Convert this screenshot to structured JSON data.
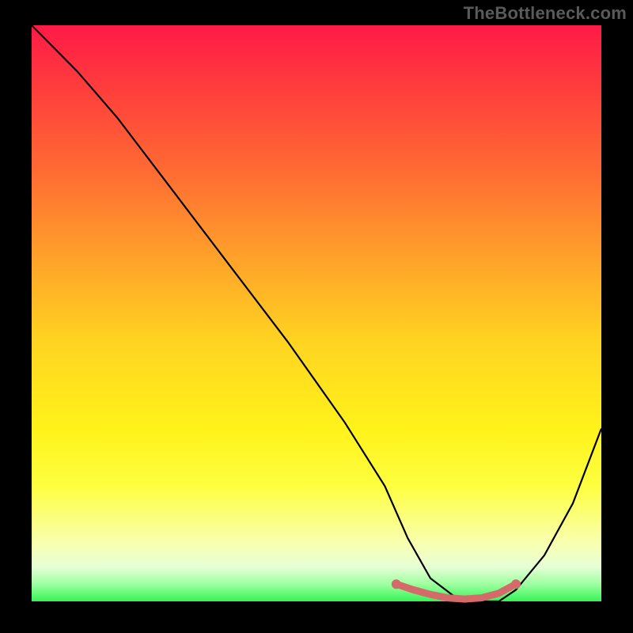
{
  "watermark": "TheBottleneck.com",
  "chart_data": {
    "type": "line",
    "title": "",
    "xlabel": "",
    "ylabel": "",
    "xlim": [
      0,
      100
    ],
    "ylim": [
      0,
      100
    ],
    "series": [
      {
        "name": "bottleneck-curve",
        "x": [
          0,
          3,
          8,
          15,
          25,
          35,
          45,
          55,
          62,
          66,
          70,
          74,
          78,
          82,
          85,
          90,
          95,
          100
        ],
        "values": [
          100,
          97,
          92,
          84,
          71,
          58,
          45,
          31,
          20,
          11,
          4,
          1,
          0,
          0,
          2,
          8,
          17,
          30
        ]
      },
      {
        "name": "highlight-band",
        "x": [
          64,
          67,
          70,
          73,
          76,
          79,
          82,
          85
        ],
        "values": [
          3,
          2,
          1.2,
          0.6,
          0.4,
          0.6,
          1.4,
          3
        ]
      }
    ],
    "notes": "Black V-shaped curve over a red→green vertical gradient. Optimum (minimum) lies between x≈72–82. Pink highlight marks the flat bottom region."
  },
  "colors": {
    "curve": "#000000",
    "highlight": "#d46a6a",
    "background_top": "#ff1a47",
    "background_bottom": "#36f456"
  }
}
